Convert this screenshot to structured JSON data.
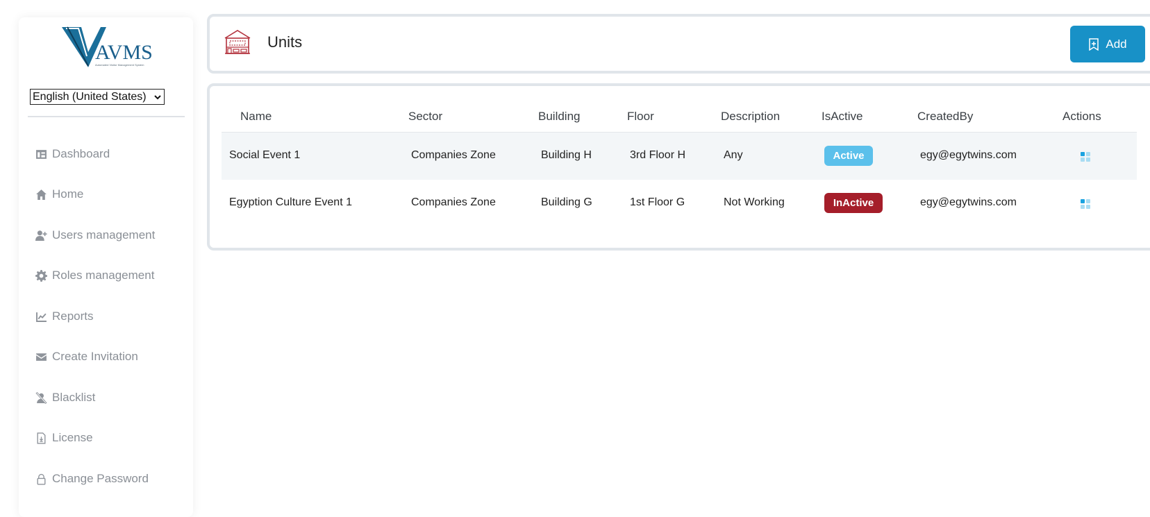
{
  "brand": {
    "logo_text": "AVMS",
    "logo_tagline": "Automated Visitor Management System"
  },
  "language": {
    "selected": "English (United States)"
  },
  "sidebar": {
    "items": [
      {
        "label": "Dashboard",
        "icon": "dashboard-icon"
      },
      {
        "label": "Home",
        "icon": "home-icon"
      },
      {
        "label": "Users management",
        "icon": "user-plus-icon"
      },
      {
        "label": "Roles management",
        "icon": "gear-icon"
      },
      {
        "label": "Reports",
        "icon": "line-chart-icon"
      },
      {
        "label": "Create Invitation",
        "icon": "envelope-icon"
      },
      {
        "label": "Blacklist",
        "icon": "user-slash-icon"
      },
      {
        "label": "License",
        "icon": "file-download-icon"
      },
      {
        "label": "Change Password",
        "icon": "lock-icon"
      }
    ]
  },
  "header": {
    "title": "Units",
    "add_label": "Add"
  },
  "table": {
    "columns": [
      "Name",
      "Sector",
      "Building",
      "Floor",
      "Description",
      "IsActive",
      "CreatedBy",
      "Actions"
    ],
    "rows": [
      {
        "name": "Social Event 1",
        "sector": "Companies Zone",
        "building": "Building H",
        "floor": "3rd Floor H",
        "description": "Any",
        "status": "Active",
        "created_by": "egy@egytwins.com"
      },
      {
        "name": "Egyption Culture Event 1",
        "sector": "Companies Zone",
        "building": "Building G",
        "floor": "1st Floor G",
        "description": "Not Working",
        "status": "InActive",
        "created_by": "egy@egytwins.com"
      }
    ]
  },
  "colors": {
    "primary": "#1891c7",
    "active_badge": "#5bc0eb",
    "inactive_badge": "#a51e2a",
    "nav_text": "#8a8f96"
  }
}
